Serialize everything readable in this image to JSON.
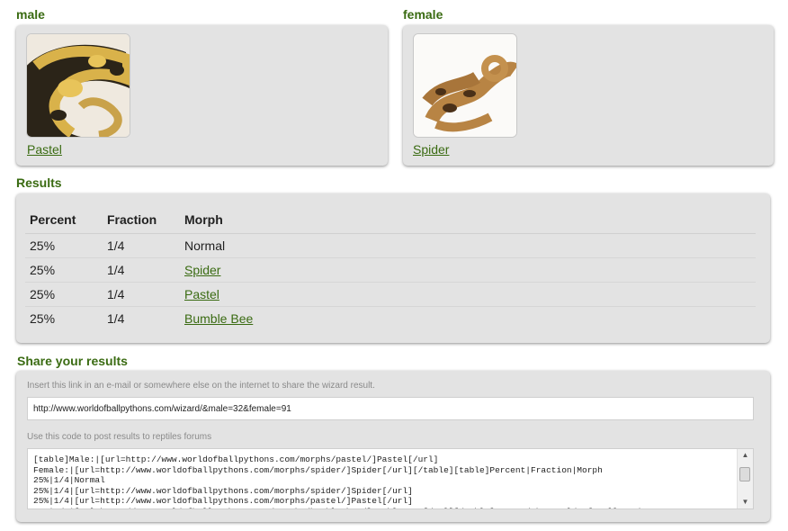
{
  "male": {
    "heading": "male",
    "morph_link": "Pastel",
    "image_icon": "ball-python-photo"
  },
  "female": {
    "heading": "female",
    "morph_link": "Spider",
    "image_icon": "ball-python-photo"
  },
  "results": {
    "heading": "Results",
    "columns": [
      "Percent",
      "Fraction",
      "Morph"
    ],
    "rows": [
      {
        "percent": "25%",
        "fraction": "1/4",
        "morph": "Normal"
      },
      {
        "percent": "25%",
        "fraction": "1/4",
        "morph": "Spider"
      },
      {
        "percent": "25%",
        "fraction": "1/4",
        "morph": "Pastel"
      },
      {
        "percent": "25%",
        "fraction": "1/4",
        "morph": "Bumble Bee"
      }
    ]
  },
  "share": {
    "heading": "Share your results",
    "link_hint": "Insert this link in an e-mail or somewhere else on the internet to share the wizard result.",
    "link_value": "http://www.worldofballpythons.com/wizard/&male=32&female=91",
    "code_hint": "Use this code to post results to reptiles forums",
    "code_value": "[table]Male:|[url=http://www.worldofballpythons.com/morphs/pastel/]Pastel[/url]\nFemale:|[url=http://www.worldofballpythons.com/morphs/spider/]Spider[/url][/table][table]Percent|Fraction|Morph\n25%|1/4|Normal\n25%|1/4|[url=http://www.worldofballpythons.com/morphs/spider/]Spider[/url]\n25%|1/4|[url=http://www.worldofballpythons.com/morphs/pastel/]Pastel[/url]\n25%|1/4|[url=http://www.worldofballpythons.com/morphs/bumble-bee/]Bumble Bee[/url][/table]Created by World of Ball Pythons"
  },
  "colors": {
    "accent_green": "#3a6b12",
    "panel_bg": "#e3e3e3"
  }
}
